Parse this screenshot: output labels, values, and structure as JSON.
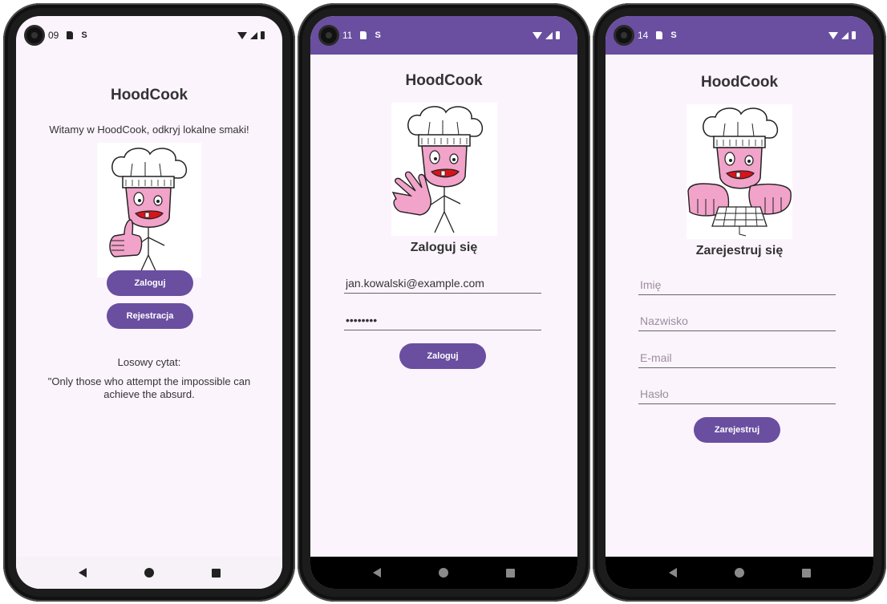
{
  "screens": [
    {
      "status_time": "09",
      "app_title": "HoodCook",
      "welcome": "Witamy w HoodCook, odkryj lokalne smaki!",
      "login_button": "Zaloguj",
      "register_button": "Rejestracja",
      "quote_label": "Losowy cytat:",
      "quote_line1": "\"Only those who attempt the impossible can",
      "quote_line2": "achieve the absurd."
    },
    {
      "status_time": "11",
      "app_title": "HoodCook",
      "heading": "Zaloguj się",
      "email_value": "jan.kowalski@example.com",
      "password_value": "••••••••",
      "login_button": "Zaloguj"
    },
    {
      "status_time": "14",
      "app_title": "HoodCook",
      "heading": "Zarejestruj się",
      "first_name_placeholder": "Imię",
      "last_name_placeholder": "Nazwisko",
      "email_placeholder": "E-mail",
      "password_placeholder": "Hasło",
      "register_button": "Zarejestruj"
    }
  ],
  "colors": {
    "accent": "#6a4fa0",
    "background": "#fcf4fd",
    "text": "#333333",
    "chef_face": "#f2a3c9",
    "tongue": "#d8141b"
  },
  "icons": {
    "status": [
      "sd-card-icon",
      "s-notification-icon",
      "wifi-icon",
      "signal-icon",
      "battery-icon"
    ],
    "nav": [
      "back-icon",
      "home-icon",
      "recents-icon"
    ]
  }
}
